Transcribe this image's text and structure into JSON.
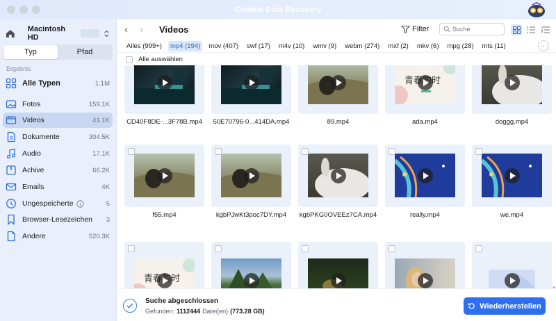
{
  "window": {
    "title": "Cisdem Data Recovery"
  },
  "sidebar": {
    "disk": "Macintosh  HD",
    "tabs": [
      {
        "label": "Typ"
      },
      {
        "label": "Pfad"
      }
    ],
    "section": "Ergebnis",
    "items": [
      {
        "label": "Alle Typen",
        "count": "1.1M",
        "icon": "grid-icon"
      },
      {
        "label": "Fotos",
        "count": "159.1K",
        "icon": "photo-icon"
      },
      {
        "label": "Videos",
        "count": "41.1K",
        "icon": "video-icon"
      },
      {
        "label": "Dokumente",
        "count": "304.5K",
        "icon": "document-icon"
      },
      {
        "label": "Audio",
        "count": "17.1K",
        "icon": "music-icon"
      },
      {
        "label": "Achive",
        "count": "66.2K",
        "icon": "archive-icon"
      },
      {
        "label": "Emails",
        "count": "4K",
        "icon": "mail-icon"
      },
      {
        "label": "Ungespeicherte",
        "count": "5",
        "icon": "unsaved-icon"
      },
      {
        "label": "Browser-Lesezeichen",
        "count": "3",
        "icon": "bookmark-icon"
      },
      {
        "label": "Andere",
        "count": "520.3K",
        "icon": "other-icon"
      }
    ]
  },
  "toolbar": {
    "title": "Videos",
    "filter_label": "Filter",
    "search_placeholder": "Suche"
  },
  "filetabs": [
    "Alles (999+)",
    "mp4 (194)",
    "mov (407)",
    "swf (17)",
    "m4v (10)",
    "wmv (9)",
    "webm (274)",
    "mxf (2)",
    "mkv (6)",
    "mpg (28)",
    "mts (11)"
  ],
  "select_all": "Alle auswählen",
  "files": [
    {
      "name": "CD40F8DE-...3F78B.mp4",
      "thumb": "dark"
    },
    {
      "name": "50E70796-0...414DA.mp4",
      "thumb": "dark"
    },
    {
      "name": "89.mp4",
      "thumb": "hill"
    },
    {
      "name": "ada.mp4",
      "thumb": "cn"
    },
    {
      "name": "doggg.mp4",
      "thumb": "rabbit"
    },
    {
      "name": "f55.mp4",
      "thumb": "hill"
    },
    {
      "name": "kgbPJwKt3poc7DY.mp4",
      "thumb": "hill"
    },
    {
      "name": "kgbPKG0OVEEz7CA.mp4",
      "thumb": "rabbit"
    },
    {
      "name": "really.mp4",
      "thumb": "blue"
    },
    {
      "name": "we.mp4",
      "thumb": "blue"
    },
    {
      "name": "",
      "thumb": "cn"
    },
    {
      "name": "",
      "thumb": "tree"
    },
    {
      "name": "",
      "thumb": "dark2"
    },
    {
      "name": "",
      "thumb": "person"
    },
    {
      "name": "",
      "thumb": "doc"
    }
  ],
  "thumb_text": "青春的时",
  "status": {
    "title": "Suche abgeschlossen",
    "found_label": "Gefunden:",
    "found_count": "1112444",
    "files_label": "Datei(en)",
    "size": "(773.28 GB)"
  },
  "recover_label": "Wiederherstellen",
  "colors": {
    "accent": "#2d6ff0",
    "sidebar_bg": "#e9f0fb",
    "selected": "#c8d8f3"
  }
}
